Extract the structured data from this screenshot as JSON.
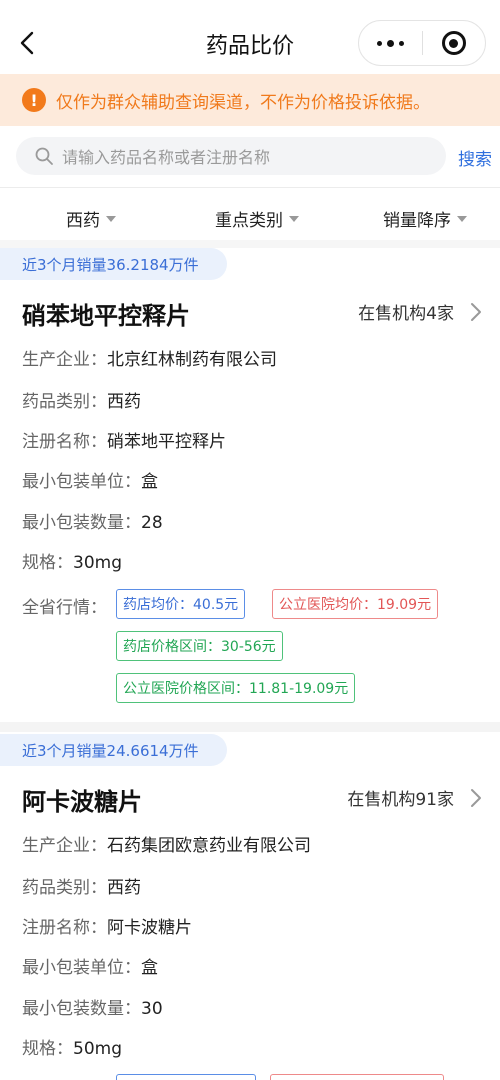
{
  "nav": {
    "title": "药品比价",
    "back_icon": "back-chevron-icon",
    "more_icon": "more-dots-icon",
    "close_icon": "miniprogram-close-icon"
  },
  "notice": {
    "icon": "warning-icon",
    "icon_glyph": "!",
    "text": "仅作为群众辅助查询渠道，不作为价格投诉依据。",
    "color": "#f07a1c",
    "background": "#fdeadb"
  },
  "search": {
    "placeholder": "请输入药品名称或者注册名称",
    "button_label": "搜索",
    "accent": "#2f6fde"
  },
  "filters": [
    {
      "label": "西药"
    },
    {
      "label": "重点类别"
    },
    {
      "label": "销量降序"
    }
  ],
  "labels": {
    "manufacturer": "生产企业：",
    "category": "药品类别：",
    "registered_name": "注册名称：",
    "min_unit": "最小包装单位：",
    "min_qty": "最小包装数量：",
    "spec": "规格：",
    "market": "全省行情："
  },
  "drugs": [
    {
      "sales": "近3个月销量36.2184万件",
      "name": "硝苯地平控释片",
      "outlets": "在售机构4家",
      "manufacturer": "北京红林制药有限公司",
      "category": "西药",
      "registered_name": "硝苯地平控释片",
      "min_unit": "盒",
      "min_qty": "28",
      "spec": "30mg",
      "tags": {
        "pharmacy_avg": "药店均价：40.5元",
        "hospital_avg": "公立医院均价：19.09元",
        "pharmacy_range": "药店价格区间：30-56元",
        "hospital_range": "公立医院价格区间：11.81-19.09元"
      }
    },
    {
      "sales": "近3个月销量24.6614万件",
      "name": "阿卡波糖片",
      "outlets": "在售机构91家",
      "manufacturer": "石药集团欧意药业有限公司",
      "category": "西药",
      "registered_name": "阿卡波糖片",
      "min_unit": "盒",
      "min_qty": "30",
      "spec": "50mg"
    }
  ]
}
